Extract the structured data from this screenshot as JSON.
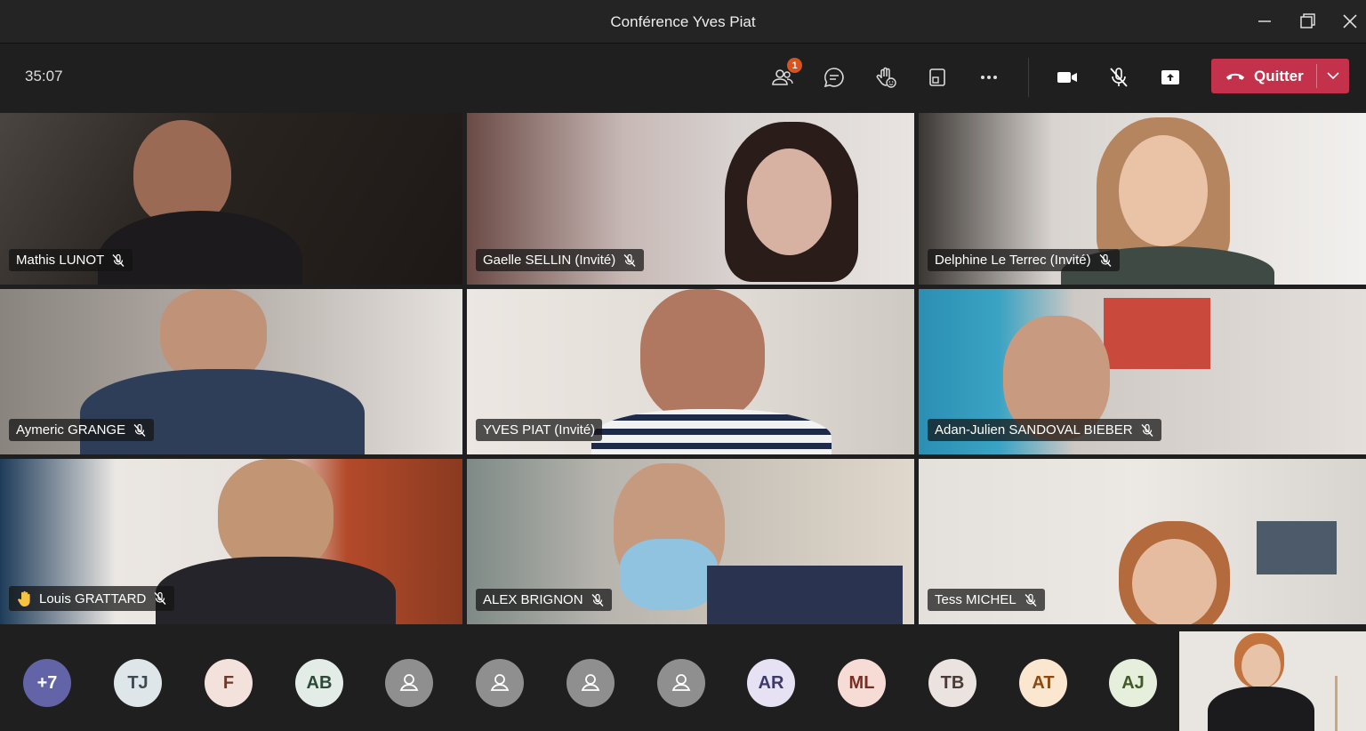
{
  "window": {
    "title": "Conférence Yves Piat"
  },
  "toolbar": {
    "timer": "35:07",
    "participants_badge": "1",
    "leave_label": "Quitter"
  },
  "tiles": [
    {
      "name": "Mathis LUNOT",
      "muted": true,
      "hand_raised": false
    },
    {
      "name": "Gaelle SELLIN (Invité)",
      "muted": true,
      "hand_raised": false
    },
    {
      "name": "Delphine Le Terrec (Invité)",
      "muted": true,
      "hand_raised": false
    },
    {
      "name": "Aymeric GRANGE",
      "muted": true,
      "hand_raised": false
    },
    {
      "name": "YVES PIAT (Invité)",
      "muted": false,
      "hand_raised": false
    },
    {
      "name": "Adan-Julien SANDOVAL BIEBER",
      "muted": true,
      "hand_raised": false
    },
    {
      "name": "Louis GRATTARD",
      "muted": true,
      "hand_raised": true
    },
    {
      "name": "ALEX BRIGNON",
      "muted": true,
      "hand_raised": false
    },
    {
      "name": "Tess MICHEL",
      "muted": true,
      "hand_raised": false
    }
  ],
  "roster": [
    {
      "initials": "+7",
      "bg": "#6264a7",
      "fg": "#ffffff",
      "icon": ""
    },
    {
      "initials": "TJ",
      "bg": "#dfe6ea",
      "fg": "#3d4a52",
      "icon": ""
    },
    {
      "initials": "F",
      "bg": "#f3e2dc",
      "fg": "#6b3a2a",
      "icon": ""
    },
    {
      "initials": "AB",
      "bg": "#e3ece6",
      "fg": "#2c4a38",
      "icon": ""
    },
    {
      "initials": "",
      "bg": "#8f8f8f",
      "fg": "#ffffff",
      "icon": "person-icon"
    },
    {
      "initials": "",
      "bg": "#8f8f8f",
      "fg": "#ffffff",
      "icon": "person-icon"
    },
    {
      "initials": "",
      "bg": "#8f8f8f",
      "fg": "#ffffff",
      "icon": "person-icon"
    },
    {
      "initials": "",
      "bg": "#8f8f8f",
      "fg": "#ffffff",
      "icon": "person-icon"
    },
    {
      "initials": "AR",
      "bg": "#e6e2f3",
      "fg": "#3d3a6b",
      "icon": ""
    },
    {
      "initials": "ML",
      "bg": "#f7dcd6",
      "fg": "#7a2e22",
      "icon": ""
    },
    {
      "initials": "TB",
      "bg": "#ebe3e0",
      "fg": "#4a3b36",
      "icon": ""
    },
    {
      "initials": "AT",
      "bg": "#fbe6d0",
      "fg": "#8a4a12",
      "icon": ""
    },
    {
      "initials": "AJ",
      "bg": "#e6efdc",
      "fg": "#3f5a28",
      "icon": ""
    }
  ],
  "colors": {
    "leave": "#c4314b",
    "badge": "#d9531e",
    "background": "#1f1f1f"
  }
}
